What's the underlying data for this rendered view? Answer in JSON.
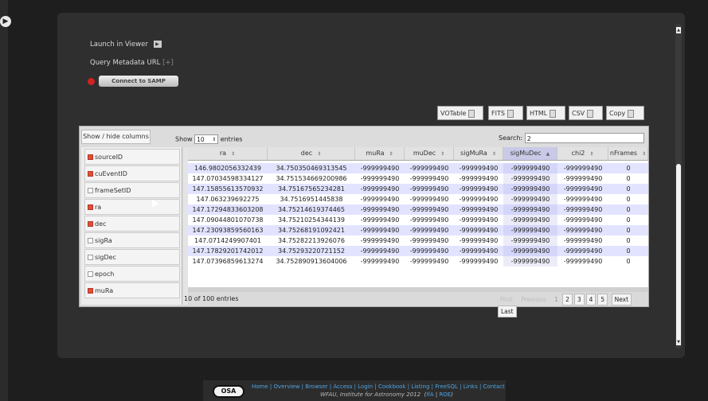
{
  "sidebar_toggle": {
    "icon": "chevron-right-icon",
    "glyph": "▶"
  },
  "viewer": {
    "launch_label": "Launch in Viewer",
    "launch_icon": "play-icon",
    "launch_glyph": "▶"
  },
  "query_meta": {
    "label": "Query Metadata URL",
    "toggle": "[+]"
  },
  "samp": {
    "button_label": "Connect to SAMP",
    "status_color": "#d22222"
  },
  "export": {
    "votable": "VOTable",
    "fits": "FITS",
    "html": "HTML",
    "csv": "CSV",
    "copy": "Copy"
  },
  "controls": {
    "showhide_label": "Show / hide columns",
    "show_label": "Show",
    "length_value": "10",
    "entries_label": "entries",
    "search_label": "Search:",
    "search_value": "2"
  },
  "column_menu": [
    {
      "label": "sourceID",
      "checked": true
    },
    {
      "label": "cuEventID",
      "checked": true
    },
    {
      "label": "frameSetID",
      "checked": false
    },
    {
      "label": "ra",
      "checked": true
    },
    {
      "label": "dec",
      "checked": true
    },
    {
      "label": "sigRa",
      "checked": false
    },
    {
      "label": "sigDec",
      "checked": false
    },
    {
      "label": "epoch",
      "checked": false
    },
    {
      "label": "muRa",
      "checked": true
    }
  ],
  "table": {
    "columns": [
      "ra",
      "dec",
      "muRa",
      "muDec",
      "sigMuRa",
      "sigMuDec",
      "chi2",
      "nFrames"
    ],
    "sorted_column": "sigMuDec",
    "rows": [
      [
        "146.9802056332439",
        "34.750350469313545",
        "-999999490",
        "-999999490",
        "-999999490",
        "-999999490",
        "-999999490",
        "0"
      ],
      [
        "147.07034598334127",
        "34.751534669200986",
        "-999999490",
        "-999999490",
        "-999999490",
        "-999999490",
        "-999999490",
        "0"
      ],
      [
        "147.15855613570932",
        "34.75167565234281",
        "-999999490",
        "-999999490",
        "-999999490",
        "-999999490",
        "-999999490",
        "0"
      ],
      [
        "147.063239692275",
        "34.7516951445838",
        "-999999490",
        "-999999490",
        "-999999490",
        "-999999490",
        "-999999490",
        "0"
      ],
      [
        "147.17294833603208",
        "34.75214619374465",
        "-999999490",
        "-999999490",
        "-999999490",
        "-999999490",
        "-999999490",
        "0"
      ],
      [
        "147.09044801070738",
        "34.75210254344139",
        "-999999490",
        "-999999490",
        "-999999490",
        "-999999490",
        "-999999490",
        "0"
      ],
      [
        "147.23093859560163",
        "34.75268191092421",
        "-999999490",
        "-999999490",
        "-999999490",
        "-999999490",
        "-999999490",
        "0"
      ],
      [
        "147.0714249907401",
        "34.75282213926076",
        "-999999490",
        "-999999490",
        "-999999490",
        "-999999490",
        "-999999490",
        "0"
      ],
      [
        "147.17829201742012",
        "34.75293220721152",
        "-999999490",
        "-999999490",
        "-999999490",
        "-999999490",
        "-999999490",
        "0"
      ],
      [
        "147.07396859613274",
        "34.752890913604006",
        "-999999490",
        "-999999490",
        "-999999490",
        "-999999490",
        "-999999490",
        "0"
      ]
    ]
  },
  "pagination": {
    "info": "10 of 100 entries",
    "first": "First",
    "previous": "Previous",
    "pages": [
      "1",
      "2",
      "3",
      "4",
      "5"
    ],
    "current_page": "1",
    "next": "Next",
    "last": "Last"
  },
  "footer": {
    "logo": "OSA",
    "links": [
      "Home",
      "Overview",
      "Browser",
      "Access",
      "Login",
      "Cookbook",
      "Listing",
      "FreeSQL",
      "Links",
      "Contact"
    ],
    "credit": "WFAU, Institute for Astronomy 2012",
    "credit_links": [
      "IfA",
      "ROE"
    ]
  }
}
